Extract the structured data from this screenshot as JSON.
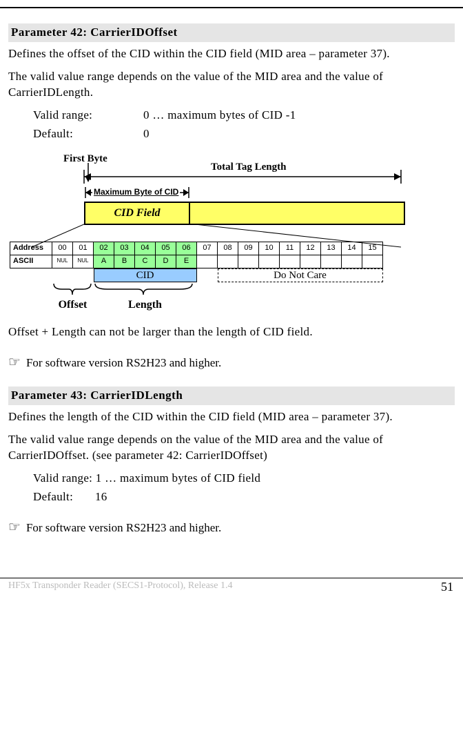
{
  "param42": {
    "header": "Parameter 42: CarrierIDOffset",
    "p1": "Defines the offset of the CID within the CID field (MID area – parameter 37).",
    "p2": "The valid value range depends on the value of the MID area and the value of CarrierIDLength.",
    "valid_range_label": "Valid range:",
    "valid_range_value": "0 … maximum bytes of CID -1",
    "default_label": "Default:",
    "default_value": "0",
    "note": "For software version RS2H23 and higher.",
    "after_diagram": "Offset + Length can not be larger than the length of CID field."
  },
  "diagram": {
    "first_byte": "First Byte",
    "total_tag_length": "Total Tag Length",
    "max_byte": "Maximum Byte of CID",
    "cid_field": "CID Field",
    "addr_label": "Address",
    "ascii_label": "ASCII",
    "addresses": [
      "00",
      "01",
      "02",
      "03",
      "04",
      "05",
      "06",
      "07",
      "08",
      "09",
      "10",
      "11",
      "12",
      "13",
      "14",
      "15"
    ],
    "ascii": [
      "NUL",
      "NUL",
      "A",
      "B",
      "C",
      "D",
      "E",
      "",
      "",
      "",
      "",
      "",
      "",
      "",
      "",
      ""
    ],
    "cid_bar": "CID",
    "dnc_bar": "Do Not Care",
    "offset_label": "Offset",
    "length_label": "Length"
  },
  "param43": {
    "header": "Parameter 43: CarrierIDLength",
    "p1": "Defines the length of the CID within the CID field (MID area – parameter 37).",
    "p2": "The valid value range depends on the value of the MID area and the value of CarrierIDOffset. (see parameter 42: CarrierIDOffset)",
    "valid_range_line": "Valid range: 1 … maximum bytes of CID field",
    "default_line": "Default:       16",
    "note": "For software version RS2H23 and higher."
  },
  "footer": {
    "text": "HF5x Transponder Reader (SECS1-Protocol), Release 1.4",
    "page": "51"
  }
}
